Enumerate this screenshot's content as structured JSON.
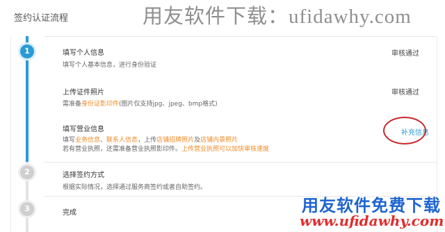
{
  "page": {
    "title": "签约认证流程"
  },
  "watermark": {
    "top_text": "用友软件下载：ufidawhy.com",
    "logo_text": "用友软件免费下载",
    "url_text": "www.ufidawhy.com"
  },
  "steps": [
    {
      "number": "1",
      "state": "active"
    },
    {
      "number": "2",
      "state": "pending"
    },
    {
      "number": "3",
      "state": "pending"
    }
  ],
  "step1": {
    "items": [
      {
        "title": "填写个人信息",
        "desc": "填写个人基本信息，进行身份验证",
        "status": "审核通过"
      },
      {
        "title": "上传证件照片",
        "desc_parts": [
          "需准备",
          "身份证影印件",
          "(图片仅支持jpg、jpeg、bmp格式)"
        ],
        "status": "审核通过"
      },
      {
        "title": "填写营业信息",
        "desc_parts": [
          "填写",
          "业务信息",
          "、",
          "联系人信息",
          "，上传",
          "店铺招牌照片",
          "及",
          "店铺内景照片"
        ],
        "desc2_parts": [
          "若有营业执照，还需准备营业执照影印件。",
          "上传营业执照可以加快审核速度"
        ],
        "action": "补充信息"
      }
    ]
  },
  "step2": {
    "title": "选择签约方式",
    "desc": "根据实际情况，选择通过服务商签约或者自助签约。"
  },
  "step3": {
    "title": "完成"
  },
  "colors": {
    "accent": "#2a9bd6",
    "highlight": "#f08a24",
    "annotation": "#c8282c"
  }
}
